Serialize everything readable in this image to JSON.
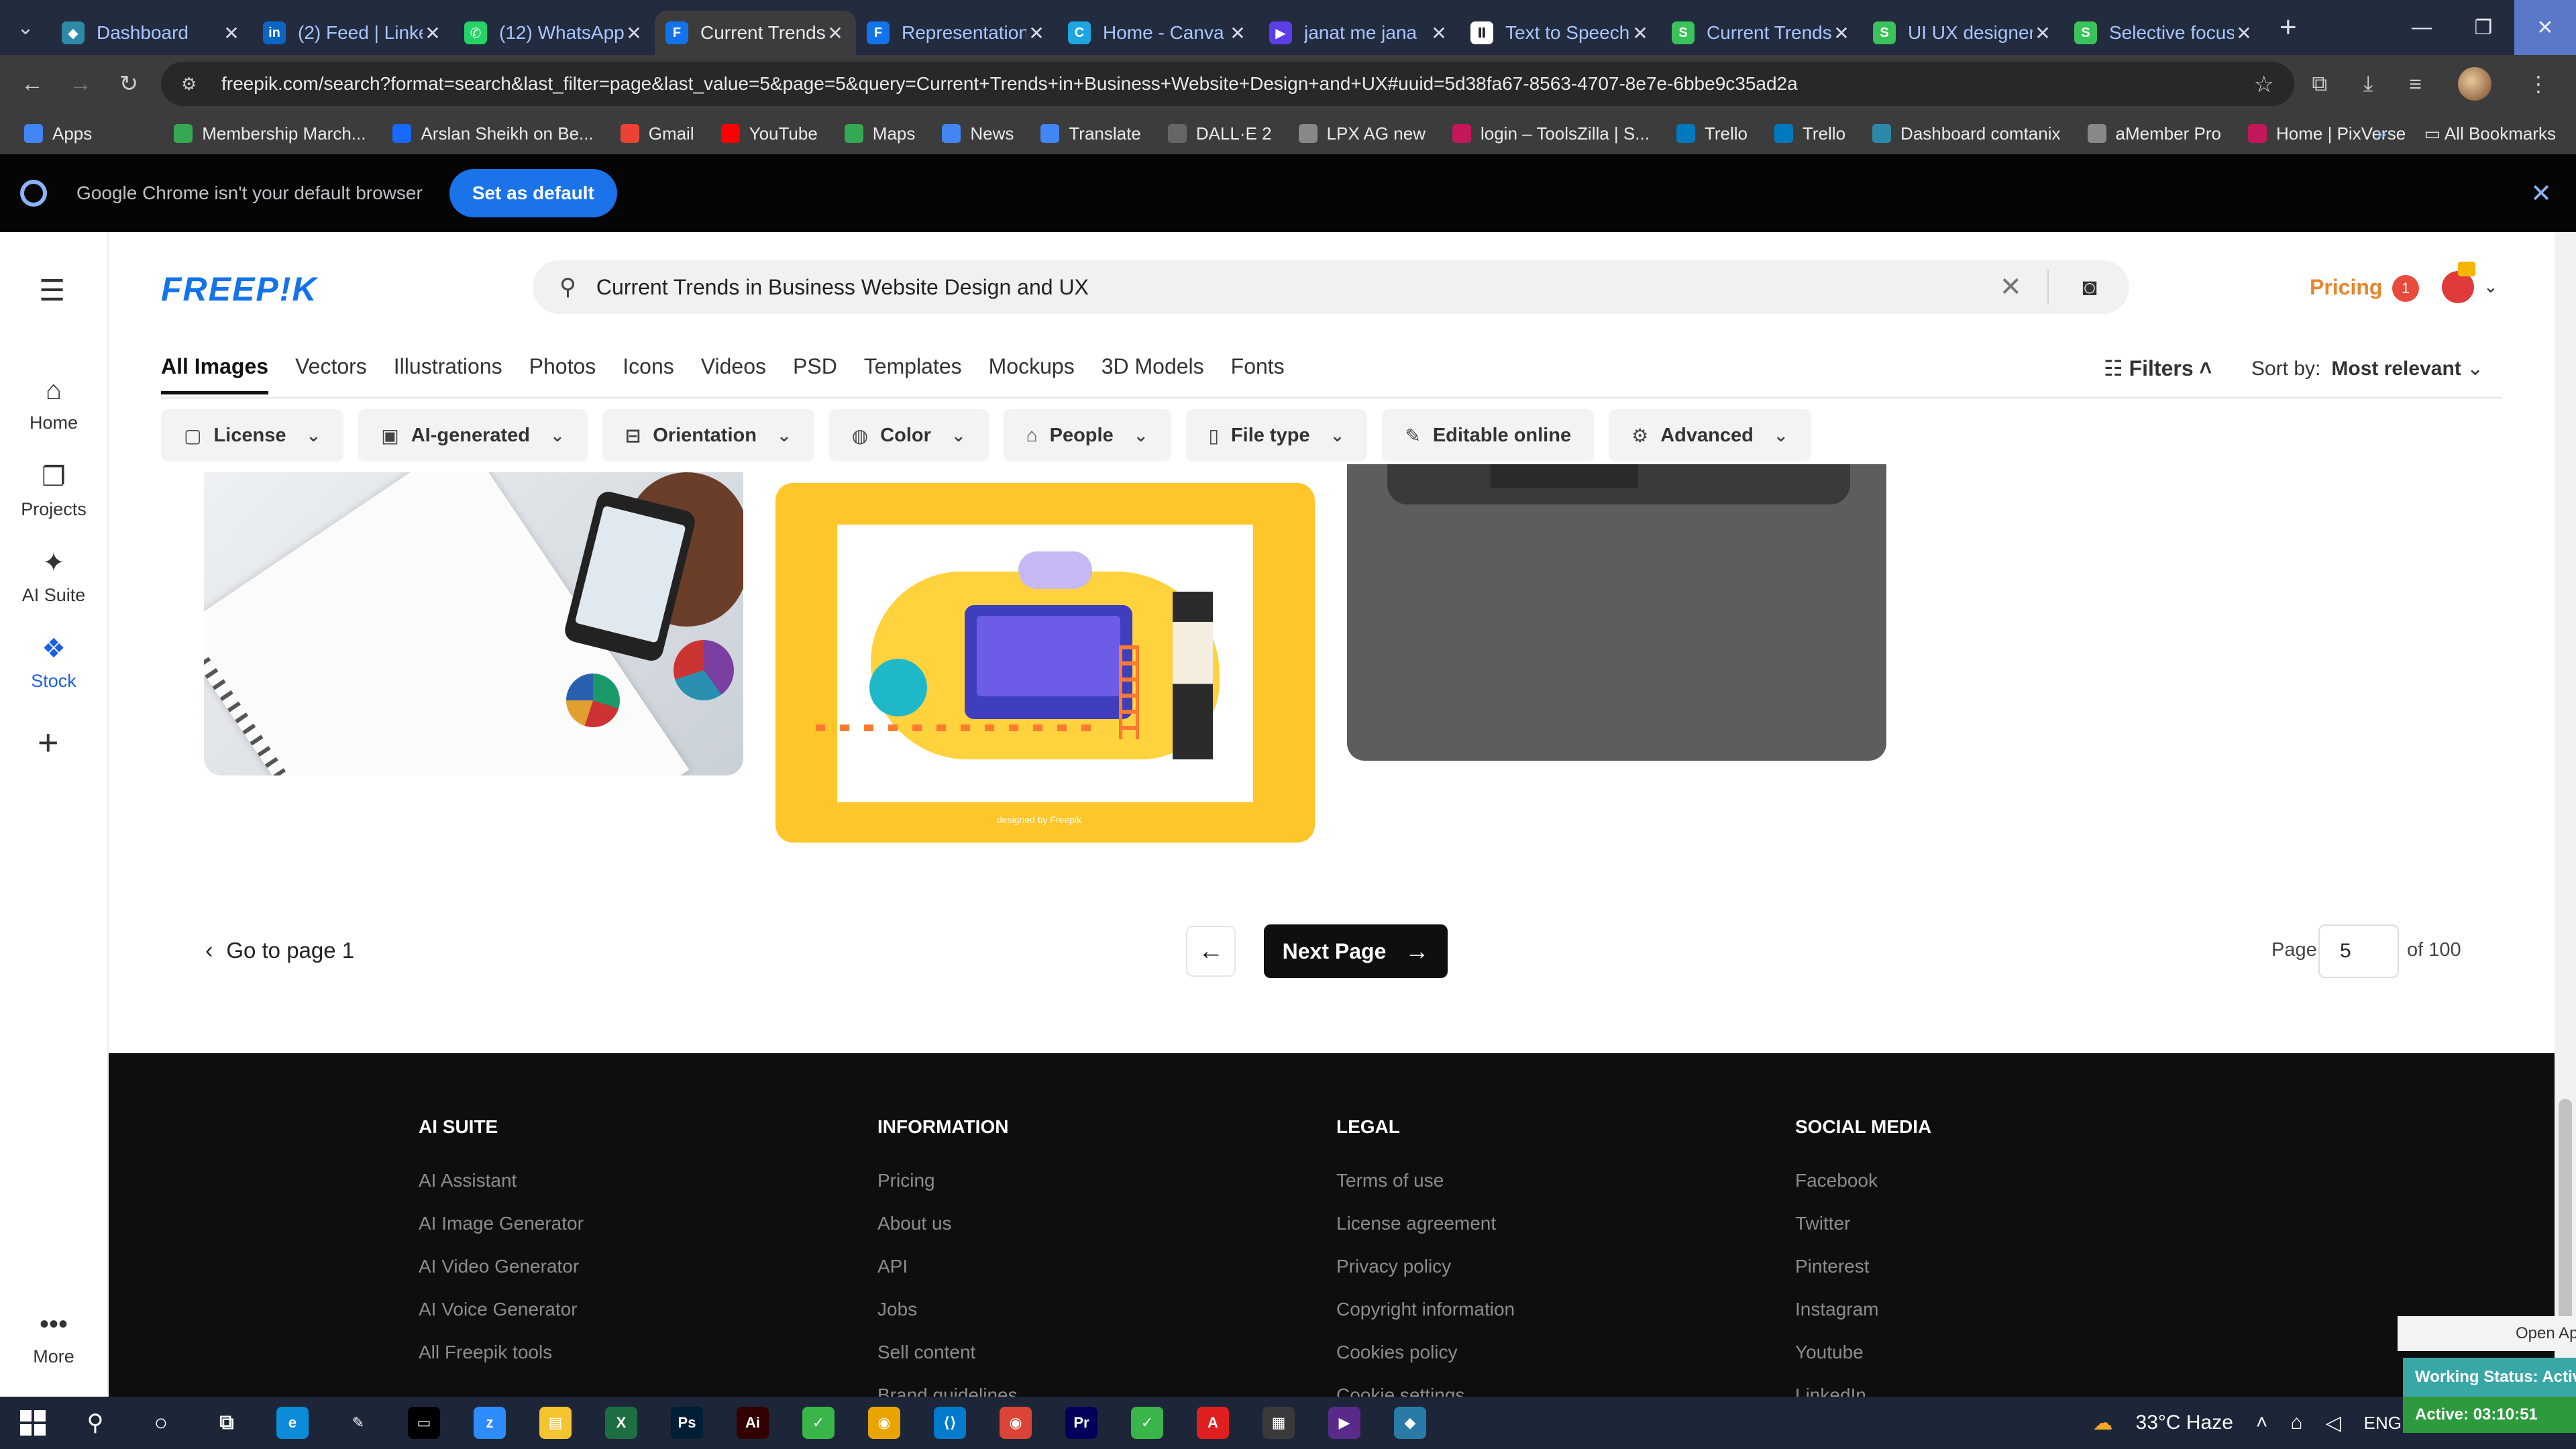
{
  "browser": {
    "tabs": [
      {
        "title": "Dashboard",
        "color": "#2d89a8",
        "glyph": "◆",
        "active": false
      },
      {
        "title": "(2) Feed | LinkedIn",
        "color": "#0a66c2",
        "glyph": "in",
        "active": false
      },
      {
        "title": "(12) WhatsApp",
        "color": "#25d366",
        "glyph": "✆",
        "active": false
      },
      {
        "title": "Current Trends",
        "color": "#1273eb",
        "glyph": "F",
        "active": true
      },
      {
        "title": "Representation",
        "color": "#1273eb",
        "glyph": "F",
        "active": false
      },
      {
        "title": "Home - Canva",
        "color": "#1fa6e0",
        "glyph": "C",
        "active": false
      },
      {
        "title": "janat me jana",
        "color": "#5b3ee8",
        "glyph": "▶",
        "active": false
      },
      {
        "title": "Text to Speech",
        "color": "#ffffff",
        "glyph": "Ⅱ",
        "active": false
      },
      {
        "title": "Current Trends",
        "color": "#3ac35a",
        "glyph": "S",
        "active": false
      },
      {
        "title": "UI UX designer",
        "color": "#3ac35a",
        "glyph": "S",
        "active": false
      },
      {
        "title": "Selective focus",
        "color": "#3ac35a",
        "glyph": "S",
        "active": false
      }
    ],
    "url": "freepik.com/search?format=search&last_filter=page&last_value=5&page=5&query=Current+Trends+in+Business+Website+Design+and+UX#uuid=5d38fa67-8563-4707-8e7e-6bbe9c35ad2a",
    "bookmarks": [
      {
        "label": "Apps",
        "color": "#4285f4"
      },
      {
        "label": "",
        "color": "#3c3c3c"
      },
      {
        "label": "Membership March...",
        "color": "#34a853"
      },
      {
        "label": "Arslan Sheikh on Be...",
        "color": "#1769ff"
      },
      {
        "label": "Gmail",
        "color": "#ea4335"
      },
      {
        "label": "YouTube",
        "color": "#ff0000"
      },
      {
        "label": "Maps",
        "color": "#34a853"
      },
      {
        "label": "News",
        "color": "#4285f4"
      },
      {
        "label": "Translate",
        "color": "#4285f4"
      },
      {
        "label": "DALL·E 2",
        "color": "#666666"
      },
      {
        "label": "LPX AG new",
        "color": "#888888"
      },
      {
        "label": "login – ToolsZilla | S...",
        "color": "#c2185b"
      },
      {
        "label": "Trello",
        "color": "#0079bf"
      },
      {
        "label": "Trello",
        "color": "#0079bf"
      },
      {
        "label": "Dashboard comtanix",
        "color": "#2d89a8"
      },
      {
        "label": "aMember Pro",
        "color": "#888888"
      },
      {
        "label": "Home | PixVerse",
        "color": "#c2185b"
      }
    ],
    "all_bookmarks": "All Bookmarks",
    "infobar_text": "Google Chrome isn't your default browser",
    "set_default": "Set as default"
  },
  "sidebar": {
    "items": [
      {
        "label": "Home",
        "icon": "⌂"
      },
      {
        "label": "Projects",
        "icon": "❐"
      },
      {
        "label": "AI Suite",
        "icon": "✦"
      },
      {
        "label": "Stock",
        "icon": "❖"
      }
    ],
    "more": "More"
  },
  "header": {
    "logo": "FREEP!K",
    "search_value": "Current Trends in Business Website Design and UX",
    "pricing": "Pricing",
    "notif_count": "1"
  },
  "categories": [
    "All Images",
    "Vectors",
    "Illustrations",
    "Photos",
    "Icons",
    "Videos",
    "PSD",
    "Templates",
    "Mockups",
    "3D Models",
    "Fonts"
  ],
  "filters_label": "Filters",
  "sort_label": "Sort by:",
  "sort_value": "Most relevant",
  "chips": [
    {
      "label": "License",
      "icon": "▢"
    },
    {
      "label": "AI-generated",
      "icon": "▣"
    },
    {
      "label": "Orientation",
      "icon": "⊟"
    },
    {
      "label": "Color",
      "icon": "◍"
    },
    {
      "label": "People",
      "icon": "⌂"
    },
    {
      "label": "File type",
      "icon": "▯"
    },
    {
      "label": "Editable online",
      "icon": "✎"
    },
    {
      "label": "Advanced",
      "icon": "⚙"
    }
  ],
  "image_credit": "designed by Freepik",
  "pagination": {
    "go_to_page1": "Go to page 1",
    "next": "Next Page",
    "page_label": "Page",
    "page_value": "5",
    "of_label": "of 100"
  },
  "footer": {
    "columns": [
      {
        "heading": "AI SUITE",
        "links": [
          "AI Assistant",
          "AI Image Generator",
          "AI Video Generator",
          "AI Voice Generator",
          "All Freepik tools"
        ]
      },
      {
        "heading": "INFORMATION",
        "links": [
          "Pricing",
          "About us",
          "API",
          "Jobs",
          "Sell content",
          "Brand guidelines"
        ]
      },
      {
        "heading": "LEGAL",
        "links": [
          "Terms of use",
          "License agreement",
          "Privacy policy",
          "Copyright information",
          "Cookies policy",
          "Cookie settings"
        ]
      },
      {
        "heading": "SOCIAL MEDIA",
        "links": [
          "Facebook",
          "Twitter",
          "Pinterest",
          "Instagram",
          "Youtube",
          "LinkedIn"
        ]
      }
    ]
  },
  "overlay": {
    "open_app": "Open App",
    "working_status": "Working Status: Active",
    "active_timer": "Active: 03:10:51"
  },
  "taskbar": {
    "weather": "33°C  Haze",
    "lang": "ENG",
    "apps": [
      {
        "name": "edge",
        "color": "#0c8bd8",
        "glyph": "e"
      },
      {
        "name": "pen",
        "color": "#1c2638",
        "glyph": "✎"
      },
      {
        "name": "terminal",
        "color": "#000000",
        "glyph": "▭"
      },
      {
        "name": "zoom",
        "color": "#2d8cff",
        "glyph": "z"
      },
      {
        "name": "files",
        "color": "#f4c430",
        "glyph": "▤"
      },
      {
        "name": "excel",
        "color": "#1d6f42",
        "glyph": "X"
      },
      {
        "name": "photoshop",
        "color": "#001e36",
        "glyph": "Ps"
      },
      {
        "name": "illustrator",
        "color": "#330000",
        "glyph": "Ai"
      },
      {
        "name": "app-green-1",
        "color": "#39b54a",
        "glyph": "✓"
      },
      {
        "name": "chrome",
        "color": "#e8a400",
        "glyph": "◉"
      },
      {
        "name": "vscode",
        "color": "#007acc",
        "glyph": "⟨⟩"
      },
      {
        "name": "chrome-active",
        "color": "#db4437",
        "glyph": "◉"
      },
      {
        "name": "premiere",
        "color": "#00005b",
        "glyph": "Pr"
      },
      {
        "name": "app-green-2",
        "color": "#39b54a",
        "glyph": "✓"
      },
      {
        "name": "acrobat",
        "color": "#e02020",
        "glyph": "A"
      },
      {
        "name": "calculator",
        "color": "#3a3a3a",
        "glyph": "▦"
      },
      {
        "name": "media",
        "color": "#5a2a8a",
        "glyph": "▶"
      },
      {
        "name": "app-gem",
        "color": "#2a7aa8",
        "glyph": "◆"
      }
    ]
  }
}
